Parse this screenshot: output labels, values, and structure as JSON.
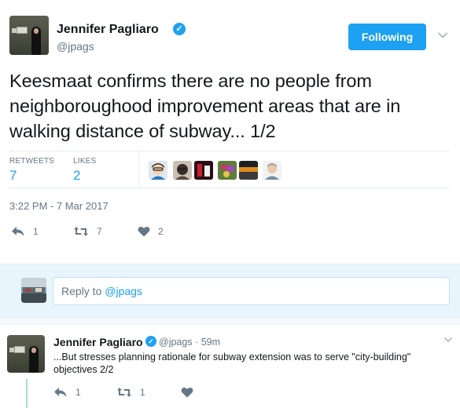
{
  "tweet": {
    "author_name": "Jennifer Pagliaro",
    "verified_icon": "verified-badge-icon",
    "handle": "@jpags",
    "follow_label": "Following",
    "text": "Keesmaat confirms there are no people from neighboroughood improvement areas that are in walking distance of subway... 1/2",
    "stats": {
      "retweets_label": "RETWEETS",
      "retweets_count": "7",
      "likes_label": "LIKES",
      "likes_count": "2"
    },
    "timestamp": "3:22 PM - 7 Mar 2017",
    "actions": {
      "reply_count": "1",
      "retweet_count": "7",
      "like_count": "2"
    }
  },
  "reply_box": {
    "prefix": "Reply to ",
    "mention": "@jpags"
  },
  "reply_tweet": {
    "author_name": "Jennifer Pagliaro",
    "handle": "@jpags",
    "separator": "·",
    "time": "59m",
    "text": "...But stresses planning rationale for subway extension was to serve \"city-building\" objectives 2/2",
    "actions": {
      "reply_count": "1",
      "retweet_count": "1",
      "like_count": ""
    }
  },
  "colors": {
    "accent": "#1da1f2",
    "muted": "#657786",
    "like_heart": "#aab8c2",
    "reply_area_bg": "#e8f5fd",
    "thread_line": "#a1e3c8"
  }
}
